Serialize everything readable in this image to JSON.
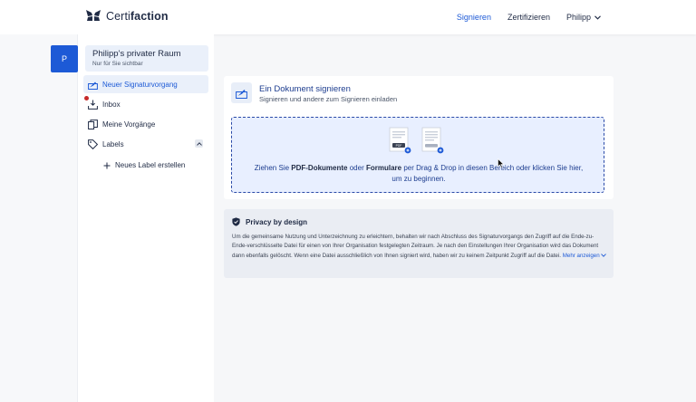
{
  "brand": {
    "name_light": "Certi",
    "name_bold": "faction",
    "logo_icon": "butterfly-logo-icon"
  },
  "nav": {
    "items": [
      "Signieren",
      "Zertifizieren"
    ],
    "active": "Signieren",
    "user": "Philipp"
  },
  "rail": {
    "avatar_letter": "P",
    "accent": "#1d5ad6"
  },
  "sidebar": {
    "space": {
      "title": "Philipp’s privater Raum",
      "subtitle": "Nur für Sie sichtbar"
    },
    "items": [
      {
        "label": "Neuer Signaturvorgang",
        "icon": "sign-document-icon",
        "active": true
      },
      {
        "label": "Inbox",
        "icon": "inbox-icon",
        "notification": true
      },
      {
        "label": "Meine Vorgänge",
        "icon": "documents-icon"
      },
      {
        "label": "Labels",
        "icon": "tag-icon",
        "expanded": true
      }
    ],
    "new_label": "Neues Label erstellen"
  },
  "card": {
    "title": "Ein Dokument signieren",
    "subtitle": "Signieren und andere zum Signieren einladen",
    "drop": {
      "pdf_badge": "PDF",
      "text_before": "Ziehen Sie ",
      "bold1": "PDF-Dokumente",
      "text_mid": " oder ",
      "bold2": "Formulare",
      "text_after": " per Drag & Drop in diesen Bereich oder klicken Sie hier, um zu beginnen."
    }
  },
  "privacy": {
    "title": "Privacy by design",
    "text": "Um die gemeinsame Nutzung und Unterzeichnung zu erleichtern, behalten wir nach Abschluss des Signaturvorgangs den Zugriff auf die Ende-zu-Ende-verschlüsselte Datei für einen von Ihrer Organisation festgelegten Zeitraum. Je nach den Einstellungen Ihrer Organisation wird das Dokument dann ebenfalls gelöscht. Wenn eine Datei ausschließlich von Ihnen signiert wird, haben wir zu keinem Zeitpunkt Zugriff auf die Datei.",
    "more": "Mehr anzeigen"
  }
}
